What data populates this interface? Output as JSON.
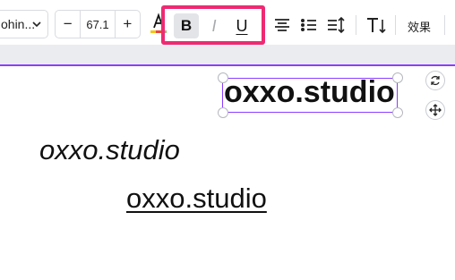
{
  "toolbar": {
    "font_name": "ohin...",
    "font_size": "67.1",
    "minus_label": "−",
    "plus_label": "+",
    "bold_label": "B",
    "italic_label": "I",
    "underline_label": "U",
    "effects_label": "效果",
    "accent_color": "#ee2a73",
    "text_color_bar": "#e9473c"
  },
  "canvas": {
    "text_bold": "oxxo.studio",
    "text_italic": "oxxo.studio",
    "text_underline": "oxxo.studio",
    "selection_color": "#8b3dff"
  }
}
